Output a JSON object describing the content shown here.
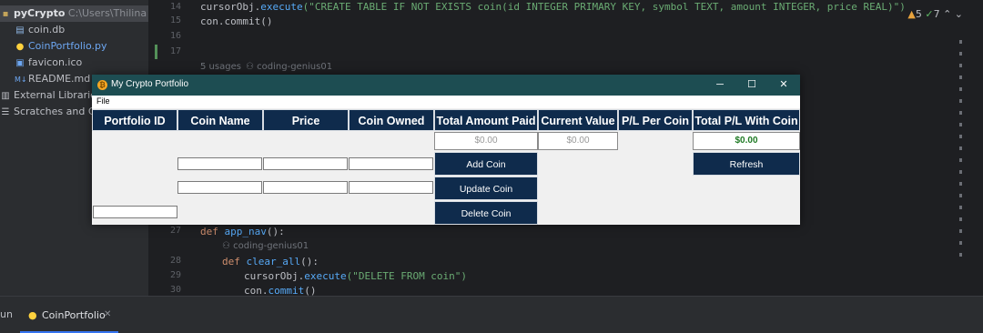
{
  "project_tree": {
    "root_name": "pyCrypto",
    "root_path": "C:\\Users\\Thilina Jaya",
    "files": [
      {
        "name": "coin.db",
        "icon": "database-icon"
      },
      {
        "name": "CoinPortfolio.py",
        "icon": "python-icon"
      },
      {
        "name": "favicon.ico",
        "icon": "image-icon"
      },
      {
        "name": "README.md",
        "icon": "markdown-icon"
      }
    ],
    "external_libraries": "External Libraries",
    "scratches": "Scratches and Co"
  },
  "editor": {
    "lines_top": [
      {
        "no": "14",
        "code_pre": "cursorObj.",
        "code_meth": "execute",
        "code_str": "(\"CREATE TABLE IF NOT EXISTS coin(id INTEGER PRIMARY KEY, symbol TEXT, amount INTEGER, price REAL)\")"
      },
      {
        "no": "15",
        "text": "con.commit()"
      },
      {
        "no": "16",
        "text": ""
      },
      {
        "no": "17",
        "text": ""
      }
    ],
    "usage_hint": "5 usages",
    "author_hint": "coding-genius01",
    "line27": {
      "no": "27",
      "kw": "def ",
      "fn": "app_nav",
      "rest": "():"
    },
    "author_hint_2": "coding-genius01",
    "line28": {
      "no": "28",
      "kw": "def ",
      "fn": "clear_all",
      "rest": "():"
    },
    "line29": {
      "no": "29",
      "pre": "cursorObj.",
      "meth": "execute",
      "str": "(\"DELETE FROM coin\")"
    },
    "line30": {
      "no": "30",
      "pre": "con.",
      "meth": "commit",
      "rest": "()"
    },
    "inspections": {
      "warnings": "5",
      "ok": "7"
    }
  },
  "bottom_bar": {
    "run_label": "un",
    "run_tab": "CoinPortfolio"
  },
  "app": {
    "title": "My Crypto Portfolio",
    "menu_file": "File",
    "columns": [
      "Portfolio ID",
      "Coin Name",
      "Price",
      "Coin Owned",
      "Total Amount Paid",
      "Current Value",
      "P/L Per Coin",
      "Total P/L With Coin"
    ],
    "total_amount_paid": "$0.00",
    "current_value": "$0.00",
    "total_pl": "$0.00",
    "buttons": {
      "add_coin": "Add Coin",
      "update_coin": "Update Coin",
      "delete_coin": "Delete Coin",
      "refresh": "Refresh"
    },
    "colors": {
      "header_bg": "#0f2b4c",
      "titlebar_bg": "#1d4d52",
      "pl_green": "#1f7a24"
    }
  }
}
